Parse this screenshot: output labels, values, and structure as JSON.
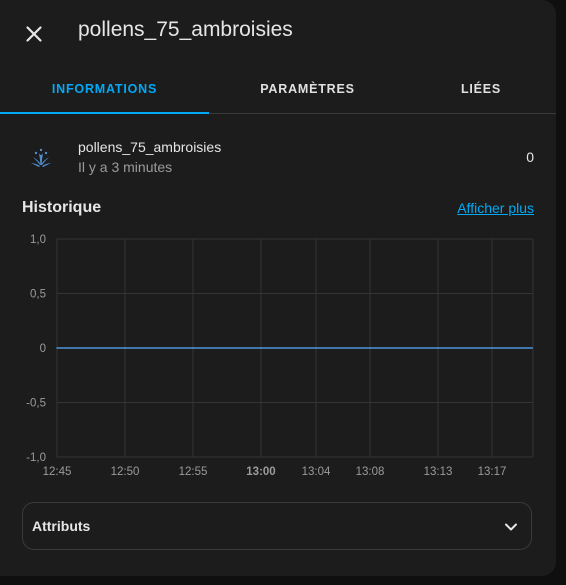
{
  "dialog": {
    "title": "pollens_75_ambroisies",
    "close_icon": "close-icon"
  },
  "tabs": [
    {
      "label": "INFORMATIONS",
      "active": true
    },
    {
      "label": "PARAMÈTRES",
      "active": false
    },
    {
      "label": "LIÉES",
      "active": false
    }
  ],
  "entity": {
    "icon": "flower-pollen-icon",
    "name": "pollens_75_ambroisies",
    "last_changed": "Il y a 3 minutes",
    "state": "0"
  },
  "history": {
    "title": "Historique",
    "more_link": "Afficher plus"
  },
  "chart_data": {
    "type": "line",
    "title": "",
    "xlabel": "",
    "ylabel": "",
    "x_ticks": [
      "12:45",
      "12:50",
      "12:55",
      "13:00",
      "13:04",
      "13:08",
      "13:13",
      "13:17"
    ],
    "x_ticks_bold": [
      "13:00"
    ],
    "y_ticks": [
      "1,0",
      "0,5",
      "0",
      "-0,5",
      "-1,0"
    ],
    "ylim": [
      -1.0,
      1.0
    ],
    "grid": true,
    "series": [
      {
        "values": [
          0,
          0,
          0,
          0,
          0,
          0,
          0,
          0
        ],
        "color": "#4d95d6"
      }
    ]
  },
  "attributes": {
    "label": "Attributs",
    "chevron_icon": "chevron-down-icon"
  },
  "colors": {
    "accent": "#03a9f4",
    "background": "#1c1c1c",
    "line": "#4d95d6"
  }
}
